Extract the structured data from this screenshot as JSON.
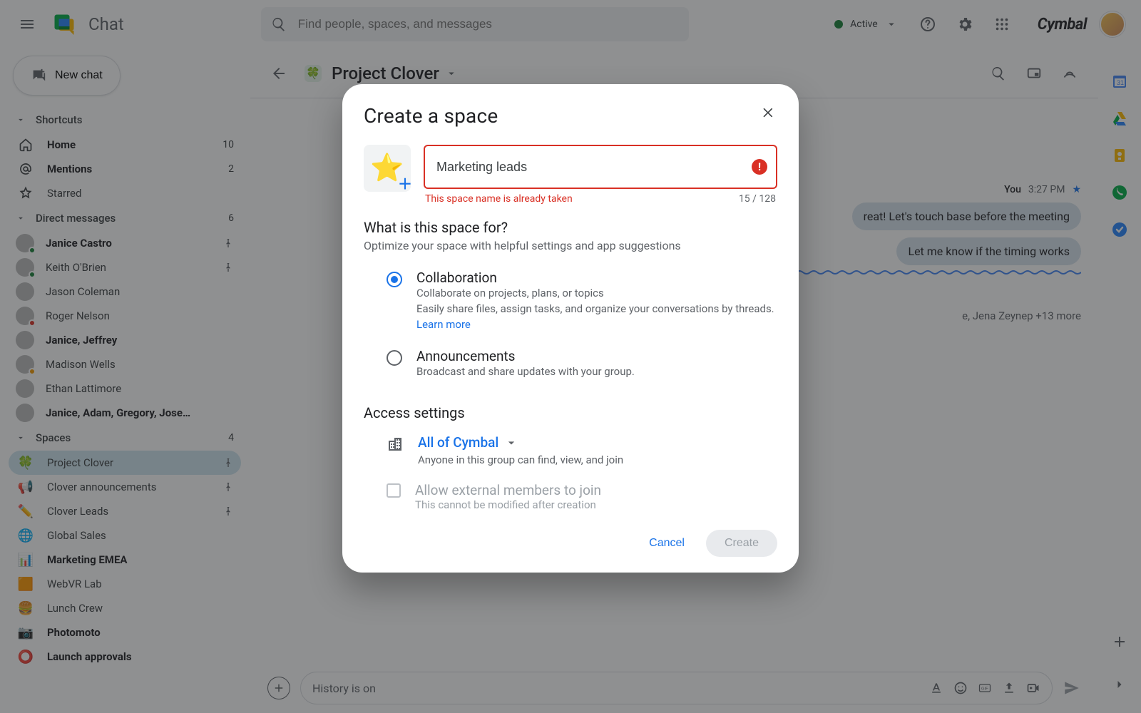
{
  "app": {
    "title": "Chat"
  },
  "search": {
    "placeholder": "Find people, spaces, and messages"
  },
  "status": {
    "label": "Active"
  },
  "org": {
    "name": "Cymbal"
  },
  "new_chat": {
    "label": "New chat"
  },
  "sections": {
    "shortcuts": {
      "label": "Shortcuts"
    },
    "dms": {
      "label": "Direct messages",
      "count": "6"
    },
    "spaces": {
      "label": "Spaces",
      "count": "4"
    }
  },
  "shortcuts": [
    {
      "label": "Home",
      "count": "10"
    },
    {
      "label": "Mentions",
      "count": "2"
    },
    {
      "label": "Starred",
      "count": ""
    }
  ],
  "dms": [
    {
      "label": "Janice Castro",
      "bold": true,
      "pinned": true,
      "presence": "green"
    },
    {
      "label": "Keith O'Brien",
      "bold": false,
      "pinned": true,
      "presence": "green"
    },
    {
      "label": "Jason Coleman",
      "bold": false,
      "pinned": false,
      "presence": ""
    },
    {
      "label": "Roger Nelson",
      "bold": false,
      "pinned": false,
      "presence": "red"
    },
    {
      "label": "Janice, Jeffrey",
      "bold": true,
      "pinned": false,
      "presence": ""
    },
    {
      "label": "Madison Wells",
      "bold": false,
      "pinned": false,
      "presence": "orange"
    },
    {
      "label": "Ethan Lattimore",
      "bold": false,
      "pinned": false,
      "presence": ""
    },
    {
      "label": "Janice, Adam, Gregory, Jose…",
      "bold": true,
      "pinned": false,
      "presence": ""
    }
  ],
  "spaces": [
    {
      "emoji": "🍀",
      "label": "Project Clover",
      "bold": false,
      "pinned": true,
      "active": true
    },
    {
      "emoji": "📢",
      "label": "Clover announcements",
      "bold": false,
      "pinned": true,
      "active": false
    },
    {
      "emoji": "✏️",
      "label": "Clover Leads",
      "bold": false,
      "pinned": true,
      "active": false
    },
    {
      "emoji": "🌐",
      "label": "Global Sales",
      "bold": false,
      "pinned": false,
      "active": false
    },
    {
      "emoji": "📊",
      "label": "Marketing EMEA",
      "bold": true,
      "pinned": false,
      "active": false
    },
    {
      "emoji": "🟧",
      "label": "WebVR Lab",
      "bold": false,
      "pinned": false,
      "active": false
    },
    {
      "emoji": "🍔",
      "label": "Lunch Crew",
      "bold": false,
      "pinned": false,
      "active": false
    },
    {
      "emoji": "📷",
      "label": "Photomoto",
      "bold": true,
      "pinned": false,
      "active": false
    },
    {
      "emoji": "⭕",
      "label": "Launch approvals",
      "bold": true,
      "pinned": false,
      "active": false
    }
  ],
  "conversation": {
    "emoji": "🍀",
    "title": "Project Clover",
    "read_by": "e, Jena Zeynep +13 more",
    "you_label": "You",
    "time": "3:27 PM",
    "msg1": "reat! Let's touch base before the meeting",
    "msg2": "Let me know if the timing works"
  },
  "composer": {
    "placeholder": "History is on"
  },
  "dialog": {
    "title": "Create a space",
    "name_value": "Marketing leads",
    "error": "This space name is already taken",
    "count": "15 / 128",
    "purpose_title": "What is this space for?",
    "purpose_sub": "Optimize your space with helpful settings and app suggestions",
    "collab": {
      "title": "Collaboration",
      "line1": "Collaborate on projects, plans, or topics",
      "line2": "Easily share files, assign tasks, and organize your conversations by threads.",
      "learn": "Learn more"
    },
    "announce": {
      "title": "Announcements",
      "desc": "Broadcast and share updates with your group."
    },
    "access_title": "Access settings",
    "access_main": "All of Cymbal",
    "access_sub": "Anyone in this group can find, view, and join",
    "ext_title": "Allow external members to join",
    "ext_sub": "This cannot be modified after creation",
    "cancel": "Cancel",
    "create": "Create"
  }
}
